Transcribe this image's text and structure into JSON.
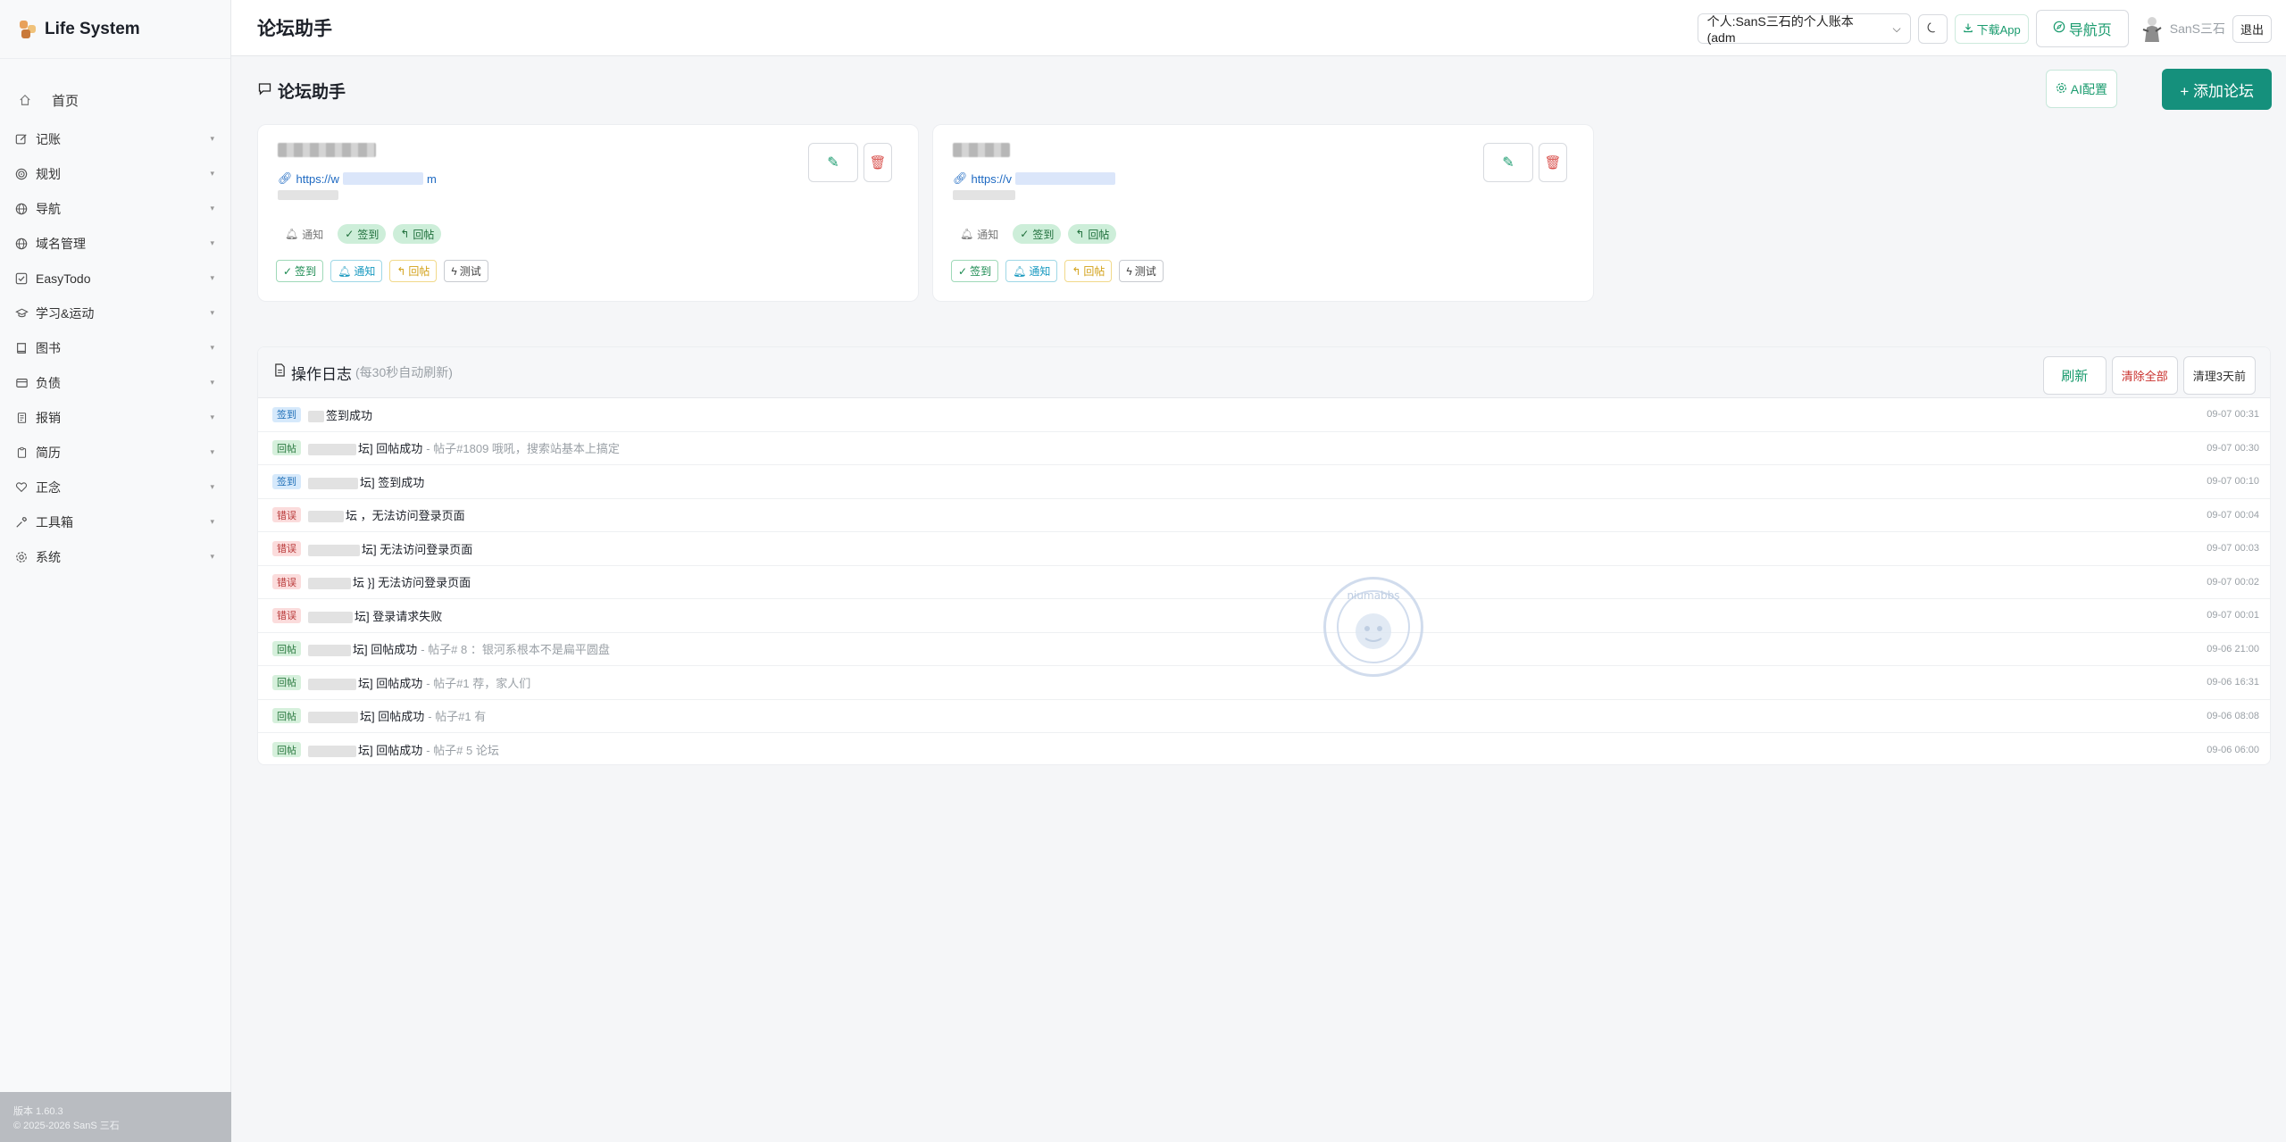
{
  "app": {
    "name": "Life System"
  },
  "sidebar": {
    "items": [
      {
        "label": "首页",
        "icon": "home-icon"
      },
      {
        "label": "记账",
        "icon": "edit-icon"
      },
      {
        "label": "规划",
        "icon": "target-icon"
      },
      {
        "label": "导航",
        "icon": "globe-icon"
      },
      {
        "label": "域名管理",
        "icon": "globe-icon"
      },
      {
        "label": "EasyTodo",
        "icon": "checkbox-icon"
      },
      {
        "label": "学习&运动",
        "icon": "graduation-icon"
      },
      {
        "label": "图书",
        "icon": "book-icon"
      },
      {
        "label": "负债",
        "icon": "card-icon"
      },
      {
        "label": "报销",
        "icon": "receipt-icon"
      },
      {
        "label": "简历",
        "icon": "clipboard-icon"
      },
      {
        "label": "正念",
        "icon": "heart-icon"
      },
      {
        "label": "工具箱",
        "icon": "wrench-icon"
      },
      {
        "label": "系统",
        "icon": "gear-icon"
      }
    ],
    "footer": {
      "version": "版本 1.60.3",
      "copyright": "© 2025-2026 SanS 三石"
    }
  },
  "header": {
    "title": "论坛助手",
    "account": "个人:SanS三石的个人账本 (adm",
    "download_label": "下载App",
    "nav_label": "导航页",
    "username": "SanS三石",
    "logout_label": "退出"
  },
  "page": {
    "section_title": "论坛助手",
    "ai_label": "AI配置",
    "add_label": "+ 添加论坛"
  },
  "cards": [
    {
      "url_prefix": "https://w",
      "url_suffix": "m",
      "tags": [
        {
          "label": "通知",
          "on": false
        },
        {
          "label": "签到",
          "on": true
        },
        {
          "label": "回帖",
          "on": true
        }
      ],
      "actions": [
        "签到",
        "通知",
        "回帖",
        "测试"
      ]
    },
    {
      "url_prefix": "https://v",
      "url_suffix": "",
      "tags": [
        {
          "label": "通知",
          "on": false
        },
        {
          "label": "签到",
          "on": true
        },
        {
          "label": "回帖",
          "on": true
        }
      ],
      "actions": [
        "签到",
        "通知",
        "回帖",
        "测试"
      ]
    }
  ],
  "log": {
    "title": "操作日志",
    "hint": "(每30秒自动刷新)",
    "refresh_label": "刷新",
    "clear_label": "清除全部",
    "clear_old_label": "清理3天前",
    "rows": [
      {
        "type": "签到",
        "color": "blue",
        "text": "签到成功",
        "extra": "",
        "time": "09-07 00:31"
      },
      {
        "type": "回帖",
        "color": "green",
        "text": "坛] 回帖成功",
        "extra": "- 帖子#1809 哦吼，搜索站基本上搞定",
        "time": "09-07 00:30"
      },
      {
        "type": "签到",
        "color": "blue",
        "text": "坛] 签到成功",
        "extra": "",
        "time": "09-07 00:10"
      },
      {
        "type": "错误",
        "color": "red",
        "text": "坛 ，无法访问登录页面",
        "extra": "",
        "time": "09-07 00:04"
      },
      {
        "type": "错误",
        "color": "red",
        "text": "坛] 无法访问登录页面",
        "extra": "",
        "time": "09-07 00:03"
      },
      {
        "type": "错误",
        "color": "red",
        "text": "坛 }] 无法访问登录页面",
        "extra": "",
        "time": "09-07 00:02"
      },
      {
        "type": "错误",
        "color": "red",
        "text": "坛] 登录请求失败",
        "extra": "",
        "time": "09-07 00:01"
      },
      {
        "type": "回帖",
        "color": "green",
        "text": "坛] 回帖成功",
        "extra": "- 帖子#   8 ：银河系根本不是扁平圆盘",
        "time": "09-06 21:00"
      },
      {
        "type": "回帖",
        "color": "green",
        "text": "坛] 回帖成功",
        "extra": "- 帖子#1   荐，家人们",
        "time": "09-06 16:31"
      },
      {
        "type": "回帖",
        "color": "green",
        "text": "坛] 回帖成功",
        "extra": "- 帖子#1   有",
        "time": "09-06 08:08"
      },
      {
        "type": "回帖",
        "color": "green",
        "text": "坛] 回帖成功",
        "extra": "- 帖子#   5   论坛",
        "time": "09-06 06:00"
      }
    ]
  },
  "colors": {
    "accent": "#15907c",
    "green_text": "#1a9b6e",
    "danger": "#d9534f"
  }
}
